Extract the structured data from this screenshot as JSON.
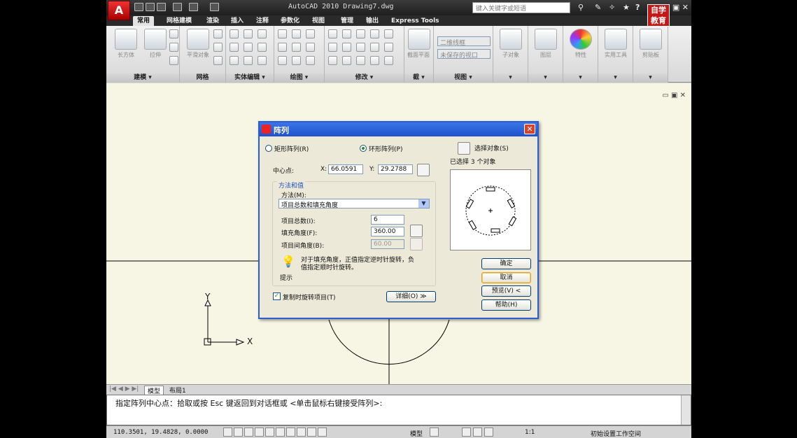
{
  "window": {
    "title": "AutoCAD 2010   Drawing7.dwg",
    "search_placeholder": "键入关键字或短语",
    "brand": "自学教育"
  },
  "tabs": [
    "常用",
    "网格建模",
    "渲染",
    "插入",
    "注释",
    "参数化",
    "视图",
    "管理",
    "输出",
    "Express Tools"
  ],
  "ribbon": {
    "panels": [
      {
        "title": "建模 ▾",
        "buttons": [
          "长方体",
          "拉伸"
        ]
      },
      {
        "title": "网格",
        "buttons": [
          "平滑对象"
        ]
      },
      {
        "title": "实体编辑 ▾"
      },
      {
        "title": "绘图 ▾"
      },
      {
        "title": "修改 ▾"
      },
      {
        "title": "截 ▾",
        "buttons": [
          "截面平面"
        ]
      },
      {
        "title": "视图 ▾",
        "dropdowns": [
          "二维线框",
          "未保存的视口"
        ]
      },
      {
        "title": "▾",
        "buttons": [
          "子对象"
        ]
      },
      {
        "title": "▾",
        "buttons": [
          "图层"
        ]
      },
      {
        "title": "▾",
        "buttons": [
          "特性"
        ]
      },
      {
        "title": "▾",
        "buttons": [
          "实用工具"
        ]
      },
      {
        "title": "▾",
        "buttons": [
          "剪贴板"
        ]
      }
    ]
  },
  "canvas": {
    "ucs_x": "X",
    "ucs_y": "Y",
    "layout_tabs": [
      "模型",
      "布局1"
    ]
  },
  "command_line": {
    "prompt": "指定阵列中心点：拾取或按 Esc 键返回到对话框或 <单击鼠标右键接受阵列>:"
  },
  "status_bar": {
    "coordinates": "110.3501, 19.4828, 0.0000",
    "model_label": "模型",
    "scale": "1:1",
    "workspace": "初始设置工作空间"
  },
  "dialog": {
    "title": "阵列",
    "rect_array_label": "矩形阵列(R)",
    "polar_array_label": "环形阵列(P)",
    "polar_selected": true,
    "select_objects_label": "选择对象(S)",
    "selected_count_text": "已选择 3 个对象",
    "center_point_label": "中心点:",
    "x_label": "X:",
    "x_value": "66.0591",
    "y_label": "Y:",
    "y_value": "29.2788",
    "group_title": "方法和值",
    "method_label": "方法(M):",
    "method_value": "项目总数和填充角度",
    "total_items_label": "项目总数(I):",
    "total_items_value": "6",
    "fill_angle_label": "填充角度(F):",
    "fill_angle_value": "360.00",
    "item_angle_label": "项目间角度(B):",
    "item_angle_value": "60.00",
    "tip_text_1": "对于填充角度，正值指定逆时针旋转，负",
    "tip_text_2": "值指定顺时针旋转。",
    "tip_label": "提示",
    "rotate_items_label": "复制时旋转项目(T)",
    "rotate_items_checked": true,
    "details_label": "详细(O)  ≫",
    "ok_label": "确定",
    "cancel_label": "取消",
    "preview_label": "预览(V)  <",
    "help_label": "帮助(H)"
  }
}
